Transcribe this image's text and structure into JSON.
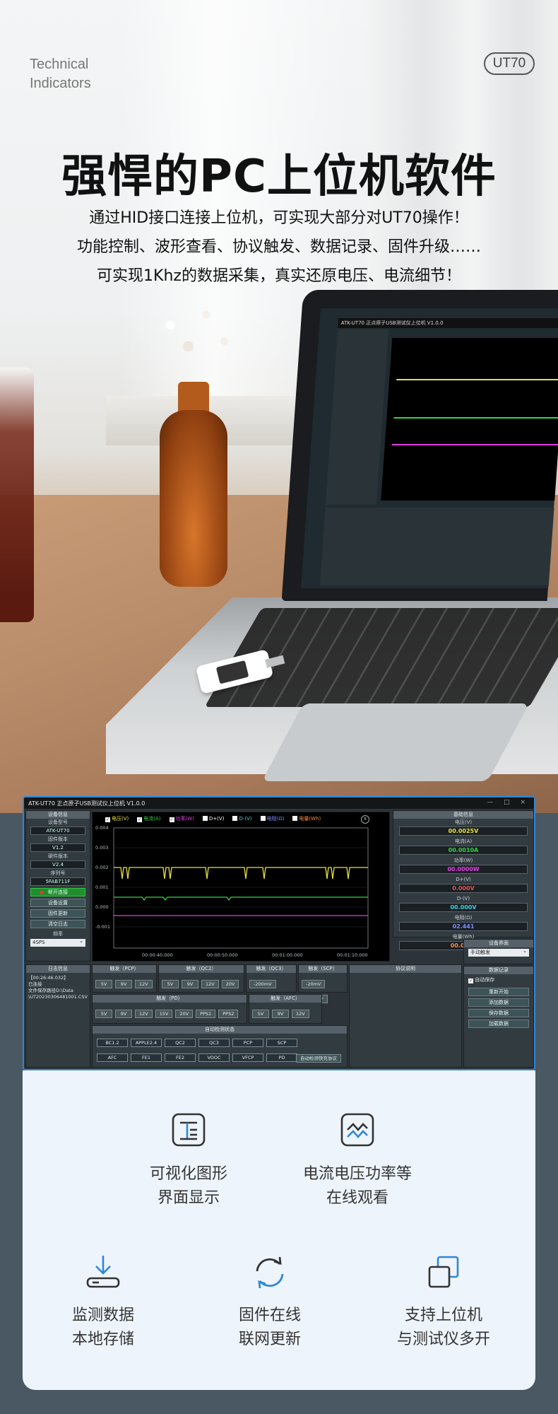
{
  "header": {
    "tech_line1": "Technical",
    "tech_line2": "Indicators",
    "model_badge": "UT70",
    "headline": "强悍的PC上位机软件",
    "sub1": "通过HID接口连接上位机，可实现大部分对UT70操作！",
    "sub2": "功能控制、波形查看、协议触发、数据记录、固件升级……",
    "sub3": "可实现1Khz的数据采集，真实还原电压、电流细节！"
  },
  "app": {
    "title": "ATK-UT70 正点原子USB测试仪上位机 V1.0.0",
    "window_controls": "— □ ×",
    "device_info": {
      "header": "设备信息",
      "model_label": "设备型号",
      "model_value": "ATK-UT70",
      "fw_label": "固件版本",
      "fw_value": "V1.2",
      "hw_label": "硬件版本",
      "hw_value": "V2.4",
      "sn_label": "序列号",
      "sn_value": "5FAB711F",
      "btn_disconnect": "断开连接",
      "btn_settings": "设备设置",
      "btn_update": "固件更新",
      "btn_clear_log": "清空日志",
      "freq_label": "频率",
      "freq_value": "4SPS"
    },
    "legend": [
      {
        "label": "电压(V)",
        "color": "#e8e13a",
        "checked": true
      },
      {
        "label": "电流(A)",
        "color": "#36d23c",
        "checked": true
      },
      {
        "label": "功率(W)",
        "color": "#e040e0",
        "checked": true
      },
      {
        "label": "D+(V)",
        "color": "#ffffff",
        "checked": false
      },
      {
        "label": "D-(V)",
        "color": "#3fd0e0",
        "checked": false
      },
      {
        "label": "电阻(Ω)",
        "color": "#7a8cff",
        "checked": false
      },
      {
        "label": "电量(Wh)",
        "color": "#ff8a3a",
        "checked": false
      }
    ],
    "plot": {
      "yticks": [
        "0.004",
        "0.003",
        "0.002",
        "0.001",
        "0.000",
        "-0.001"
      ],
      "xticks": [
        "00:00:40.000",
        "00:00:50.000",
        "00:01:00.000",
        "00:01:10.000"
      ]
    },
    "log": {
      "header": "日志信息",
      "lines": [
        "【00:26:46.032】",
        "已连接",
        "文件保存路径D:\\Data",
        "\\UT20230306481001.CSV"
      ]
    },
    "trig_pcp": {
      "header": "触发（PCP）",
      "buttons": [
        "5V",
        "9V",
        "12V"
      ]
    },
    "trig_qc2": {
      "header": "触发（QC2）",
      "buttons": [
        "5V",
        "9V",
        "12V",
        "20V"
      ]
    },
    "trig_qc3": {
      "header": "触发（QC3）",
      "buttons": [
        "-200mV",
        "+200mV"
      ]
    },
    "trig_scp": {
      "header": "触发（SCP）",
      "buttons": [
        "-20mV",
        "+20mV"
      ]
    },
    "trig_pd": {
      "header": "触发（PD）",
      "buttons": [
        "5V",
        "9V",
        "12V",
        "15V",
        "20V",
        "PPS1",
        "PPS2"
      ]
    },
    "trig_afc": {
      "header": "触发（AFC）",
      "buttons": [
        "5V",
        "9V",
        "12V"
      ]
    },
    "protocol_desc": {
      "header": "协议说明"
    },
    "auto_detect": {
      "header": "自动检测状态",
      "row1": [
        "BC1.2",
        "APPLE2.4",
        "QC2",
        "QC3",
        "PCP",
        "SCP"
      ],
      "row2": [
        "AFC",
        "FE1",
        "FE2",
        "VOOC",
        "VFCP",
        "PD"
      ],
      "btn": "自动检测快充协议"
    },
    "readings": {
      "header": "基础信息",
      "items": [
        {
          "label": "电压(V)",
          "value": "00.0025V",
          "color": "#e8e13a"
        },
        {
          "label": "电流(A)",
          "value": "00.0010A",
          "color": "#36d23c"
        },
        {
          "label": "功率(W)",
          "value": "00.0000W",
          "color": "#e040e0"
        },
        {
          "label": "D+(V)",
          "value": "0.000V",
          "color": "#e65050"
        },
        {
          "label": "D-(V)",
          "value": "00.000V",
          "color": "#3fd0e0"
        },
        {
          "label": "电阻(Ω)",
          "value": "02.441",
          "color": "#7a8cff"
        },
        {
          "label": "电量(Wh)",
          "value": "00.0000",
          "color": "#ff8a3a"
        }
      ]
    },
    "device_ui": {
      "header": "设备界面",
      "select": "手动触发"
    },
    "data_record": {
      "header": "数据记录",
      "autosave": "自动保存",
      "buttons": [
        "重新开始",
        "添加数据",
        "保存数据",
        "加载数据"
      ]
    }
  },
  "features": [
    {
      "icon": "visual-gui-icon",
      "line1": "可视化图形",
      "line2": "界面显示"
    },
    {
      "icon": "waveform-monitor-icon",
      "line1": "电流电压功率等",
      "line2": "在线观看"
    },
    {
      "icon": "download-storage-icon",
      "line1": "监测数据",
      "line2": "本地存储"
    },
    {
      "icon": "refresh-update-icon",
      "line1": "固件在线",
      "line2": "联网更新"
    },
    {
      "icon": "multi-window-icon",
      "line1": "支持上位机",
      "line2": "与测试仪多开"
    }
  ],
  "colors": {
    "accent_blue": "#2f86d6",
    "card_bg": "#eef4fb"
  }
}
